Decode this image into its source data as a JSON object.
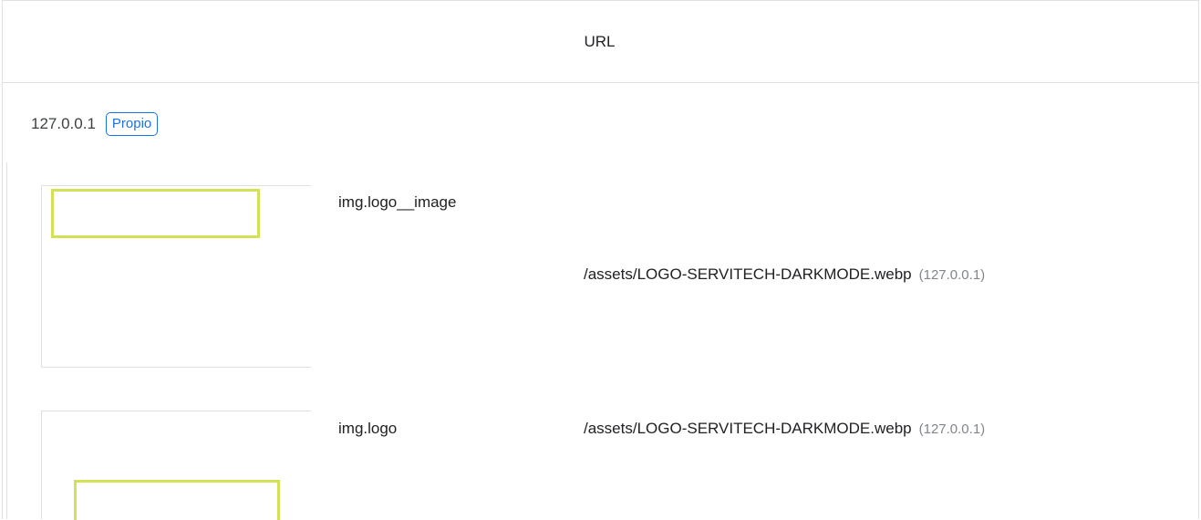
{
  "header": {
    "column_label": "URL"
  },
  "origin": {
    "host": "127.0.0.1",
    "badge": "Propio"
  },
  "items": [
    {
      "selector": "img.logo__image",
      "url": "/assets/LOGO-SERVITECH-DARKMODE.webp",
      "url_origin": "(127.0.0.1)"
    },
    {
      "selector": "img.logo",
      "url": "/assets/LOGO-SERVITECH-DARKMODE.webp",
      "url_origin": "(127.0.0.1)"
    }
  ],
  "colors": {
    "badge": "#1a73e8",
    "highlight": "#d4e157",
    "border": "#e0e0e0",
    "muted_text": "#80868b"
  }
}
